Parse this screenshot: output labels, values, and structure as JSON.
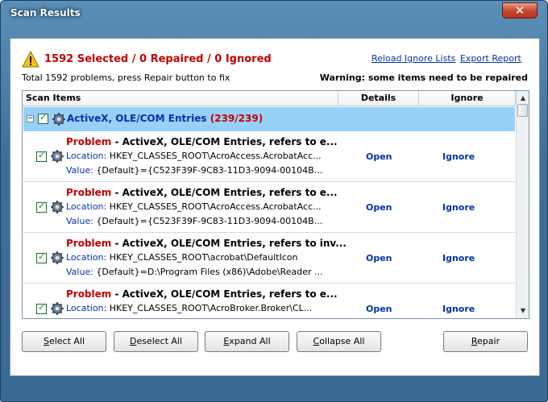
{
  "window": {
    "title": "Scan Results",
    "close_glyph": "✕"
  },
  "header": {
    "summary": "1592 Selected / 0 Repaired / 0 Ignored",
    "links": [
      "Reload Ignore Lists",
      "Export Report"
    ],
    "subtext": "Total 1592 problems, press Repair button to fix",
    "warning": "Warning: some items need to be repaired"
  },
  "table": {
    "columns": [
      "Scan Items",
      "Details",
      "Ignore"
    ],
    "group": {
      "label": "ActiveX, OLE/COM Entries",
      "count": "(239/239)",
      "expander": "−"
    },
    "items": [
      {
        "problem_label": "Problem",
        "problem_text": " - ActiveX, OLE/COM Entries, refers to e...",
        "location_label": "Location:",
        "location": "HKEY_CLASSES_ROOT\\AcroAccess.AcrobatAcc...",
        "value_label": "Value:",
        "value": "{Default}={C523F39F-9C83-11D3-9094-00104B...",
        "open": "Open",
        "ignore": "Ignore"
      },
      {
        "problem_label": "Problem",
        "problem_text": " - ActiveX, OLE/COM Entries, refers to e...",
        "location_label": "Location:",
        "location": "HKEY_CLASSES_ROOT\\AcroAccess.AcrobatAcc...",
        "value_label": "Value:",
        "value": "{Default}={C523F39F-9C83-11D3-9094-00104B...",
        "open": "Open",
        "ignore": "Ignore"
      },
      {
        "problem_label": "Problem",
        "problem_text": " - ActiveX, OLE/COM Entries, refers to inv...",
        "location_label": "Location:",
        "location": "HKEY_CLASSES_ROOT\\acrobat\\DefaultIcon",
        "value_label": "Value:",
        "value": "{Default}=D:\\Program Files (x86)\\Adobe\\Reader ...",
        "open": "Open",
        "ignore": "Ignore"
      },
      {
        "problem_label": "Problem",
        "problem_text": " - ActiveX, OLE/COM Entries, refers to e...",
        "location_label": "Location:",
        "location": "HKEY_CLASSES_ROOT\\AcroBroker.Broker\\CL...",
        "value_label": "",
        "value": "",
        "open": "Open",
        "ignore": "Ignore"
      }
    ]
  },
  "buttons": {
    "select_all": {
      "mnemonic": "S",
      "rest": "elect All"
    },
    "deselect_all": {
      "mnemonic": "D",
      "rest": "eselect All"
    },
    "expand_all": {
      "mnemonic": "E",
      "rest": "xpand All"
    },
    "collapse_all": {
      "mnemonic": "C",
      "rest": "ollapse All"
    },
    "repair": {
      "mnemonic": "R",
      "rest": "epair"
    }
  },
  "colors": {
    "accent_red": "#c40000",
    "link_blue": "#0033aa",
    "group_bg": "#99d0f7",
    "title_bar": "#3e6f9a"
  },
  "icons": {
    "warning": "warning-triangle-icon",
    "item": "gear-icon",
    "check": "checkmark-icon"
  }
}
